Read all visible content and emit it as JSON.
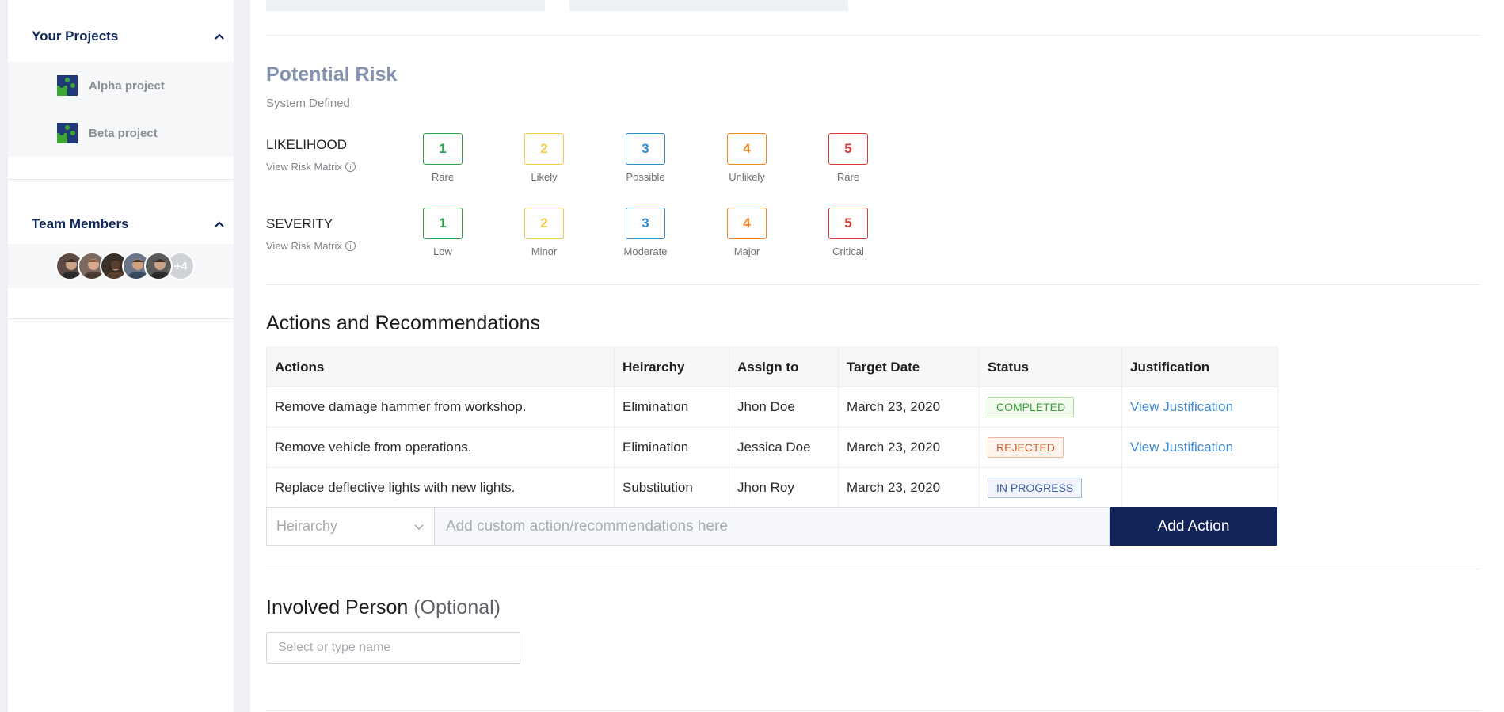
{
  "sidebar": {
    "projects_title": "Your Projects",
    "projects": [
      {
        "label": "Alpha project"
      },
      {
        "label": "Beta project"
      }
    ],
    "team_title": "Team Members",
    "team_more": "+4"
  },
  "risk": {
    "title": "Potential Risk",
    "subtitle": "System Defined",
    "matrix_link": "View Risk Matrix",
    "likelihood": {
      "label": "LIKELIHOOD",
      "scores": [
        {
          "value": "1",
          "caption": "Rare",
          "color": "#2ca24f"
        },
        {
          "value": "2",
          "caption": "Likely",
          "color": "#f2cf4a"
        },
        {
          "value": "3",
          "caption": "Possible",
          "color": "#2e8ccf"
        },
        {
          "value": "4",
          "caption": "Unlikely",
          "color": "#f2872a"
        },
        {
          "value": "5",
          "caption": "Rare",
          "color": "#e03a3a"
        }
      ]
    },
    "severity": {
      "label": "SEVERITY",
      "scores": [
        {
          "value": "1",
          "caption": "Low",
          "color": "#2ca24f"
        },
        {
          "value": "2",
          "caption": "Minor",
          "color": "#f2cf4a"
        },
        {
          "value": "3",
          "caption": "Moderate",
          "color": "#2e8ccf"
        },
        {
          "value": "4",
          "caption": "Major",
          "color": "#f2872a"
        },
        {
          "value": "5",
          "caption": "Critical",
          "color": "#e03a3a"
        }
      ]
    }
  },
  "actions": {
    "title": "Actions and Recommendations",
    "columns": [
      "Actions",
      "Heirarchy",
      "Assign to",
      "Target Date",
      "Status",
      "Justification"
    ],
    "rows": [
      {
        "action": "Remove damage hammer from workshop.",
        "hierarchy": "Elimination",
        "assignee": "Jhon Doe",
        "date": "March 23, 2020",
        "status": "COMPLETED",
        "justification": "View Justification"
      },
      {
        "action": "Remove vehicle from operations.",
        "hierarchy": "Elimination",
        "assignee": "Jessica Doe",
        "date": "March 23, 2020",
        "status": "REJECTED",
        "justification": "View Justification"
      },
      {
        "action": "Replace deflective lights with new lights.",
        "hierarchy": "Substitution",
        "assignee": "Jhon Roy",
        "date": "March 23, 2020",
        "status": "IN PROGRESS",
        "justification": ""
      }
    ],
    "hierarchy_placeholder": "Heirarchy",
    "input_placeholder": "Add custom action/recommendations here",
    "add_button": "Add Action"
  },
  "involved": {
    "title": "Involved Person",
    "optional": "(Optional)",
    "placeholder": "Select or type name"
  },
  "colors": {
    "brand_navy": "#12235a",
    "link_blue": "#3d8ad6"
  }
}
